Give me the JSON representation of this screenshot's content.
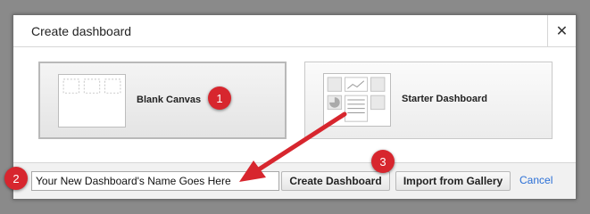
{
  "dialog": {
    "title": "Create dashboard",
    "close_icon": "close-icon"
  },
  "options": [
    {
      "label": "Blank Canvas",
      "icon": "blank-canvas-thumbnail",
      "selected": true
    },
    {
      "label": "Starter Dashboard",
      "icon": "starter-dashboard-thumbnail",
      "selected": false
    }
  ],
  "footer": {
    "name_value": "Your New Dashboard's Name Goes Here",
    "create_label": "Create Dashboard",
    "import_label": "Import from Gallery",
    "cancel_label": "Cancel"
  },
  "callouts": [
    "1",
    "2",
    "3"
  ],
  "colors": {
    "badge": "#d7262e",
    "arrow": "#d7262e",
    "link": "#2a6fd6",
    "backdrop": "#8a8a8a"
  }
}
